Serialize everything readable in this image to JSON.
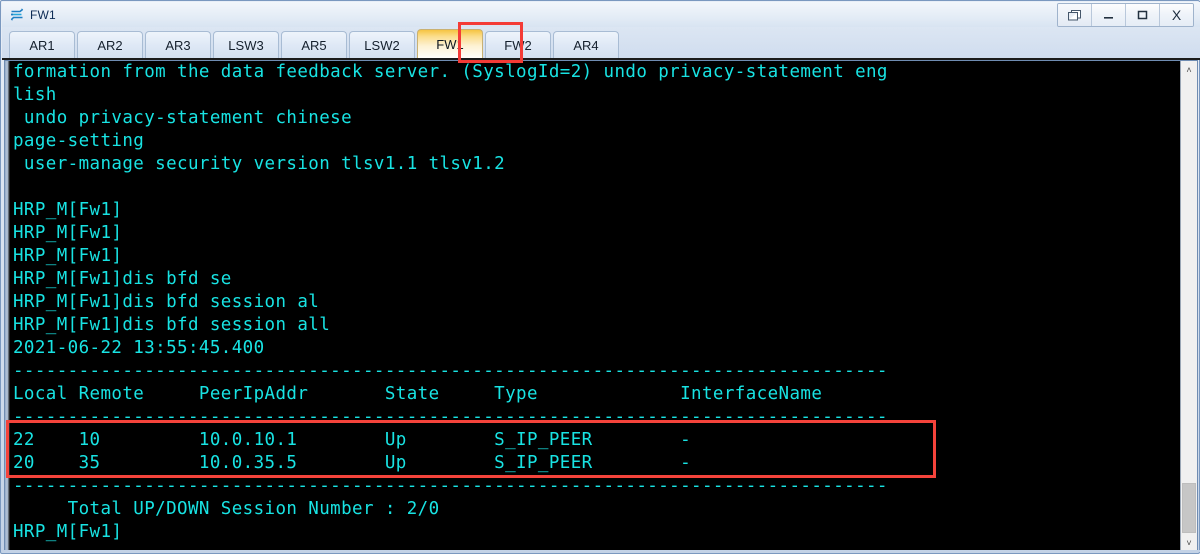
{
  "window": {
    "title": "FW1",
    "icon": "router-device-icon",
    "controls": [
      {
        "name": "restore-button",
        "glyph": "❐"
      },
      {
        "name": "minimize-button",
        "glyph": "_"
      },
      {
        "name": "maximize-button",
        "glyph": "▭"
      },
      {
        "name": "close-button",
        "glyph": "X"
      }
    ]
  },
  "tabs": {
    "items": [
      {
        "label": "AR1",
        "active": false
      },
      {
        "label": "AR2",
        "active": false
      },
      {
        "label": "AR3",
        "active": false
      },
      {
        "label": "LSW3",
        "active": false
      },
      {
        "label": "AR5",
        "active": false
      },
      {
        "label": "LSW2",
        "active": false
      },
      {
        "label": "FW1",
        "active": true
      },
      {
        "label": "FW2",
        "active": false
      },
      {
        "label": "AR4",
        "active": false
      }
    ],
    "active_label": "FW1"
  },
  "terminal": {
    "prompt": "HRP_M[Fw1]",
    "text_color": "#18e3e3",
    "background_color": "#000000",
    "lines": [
      "formation from the data feedback server. (SyslogId=2) undo privacy-statement eng",
      "lish",
      " undo privacy-statement chinese",
      "page-setting",
      " user-manage security version tlsv1.1 tlsv1.2",
      "",
      "HRP_M[Fw1]",
      "HRP_M[Fw1]",
      "HRP_M[Fw1]",
      "HRP_M[Fw1]dis bfd se",
      "HRP_M[Fw1]dis bfd session al",
      "HRP_M[Fw1]dis bfd session all",
      "2021-06-22 13:55:45.400",
      "--------------------------------------------------------------------------------",
      "Local Remote     PeerIpAddr       State     Type             InterfaceName",
      "--------------------------------------------------------------------------------",
      "22    10         10.0.10.1        Up        S_IP_PEER        -",
      "20    35         10.0.35.5        Up        S_IP_PEER        -",
      "--------------------------------------------------------------------------------",
      "     Total UP/DOWN Session Number : 2/0",
      "HRP_M[Fw1]"
    ],
    "timestamp": "2021-06-22 13:55:45.400",
    "command": "dis bfd session all",
    "summary": "     Total UP/DOWN Session Number : 2/0"
  },
  "bfd_table": {
    "headers": [
      "Local",
      "Remote",
      "PeerIpAddr",
      "State",
      "Type",
      "InterfaceName"
    ],
    "rows": [
      {
        "local": "22",
        "remote": "10",
        "peer_ip_addr": "10.0.10.1",
        "state": "Up",
        "type": "S_IP_PEER",
        "interface_name": "-"
      },
      {
        "local": "20",
        "remote": "35",
        "peer_ip_addr": "10.0.35.5",
        "state": "Up",
        "type": "S_IP_PEER",
        "interface_name": "-"
      }
    ],
    "total_up": "2",
    "total_down": "0"
  },
  "scrollbar": {
    "up_arrow": "˄",
    "down_arrow": "˅"
  },
  "annotations": {
    "highlight_color": "#f4433b",
    "boxes": [
      "active-tab-highlight",
      "bfd-session-rows-highlight"
    ]
  }
}
